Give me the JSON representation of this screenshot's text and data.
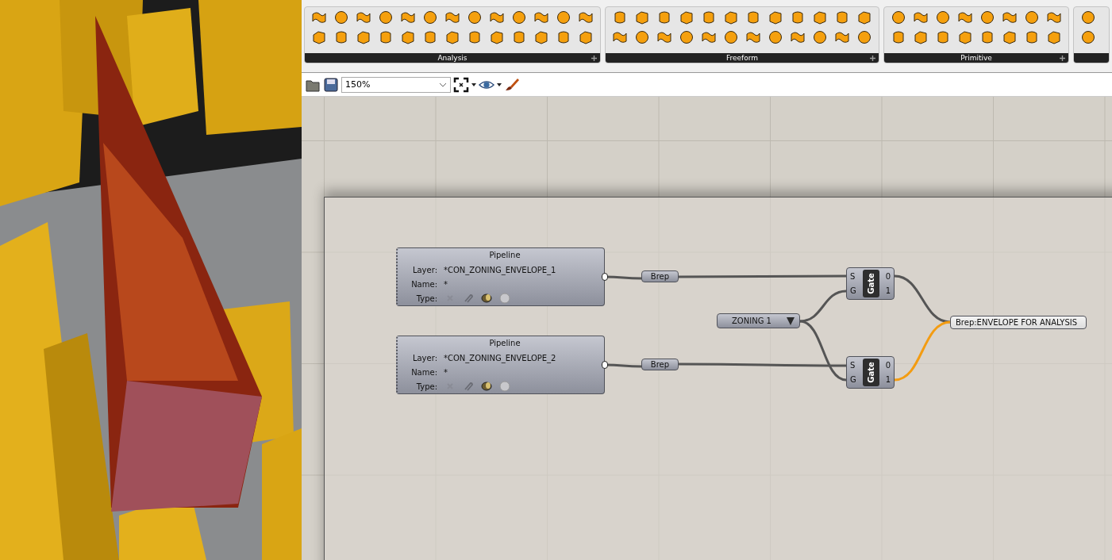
{
  "ribbon": {
    "panels": [
      {
        "label": "Analysis"
      },
      {
        "label": "Freeform"
      },
      {
        "label": "Primitive"
      }
    ]
  },
  "toolbar": {
    "zoom": "150%"
  },
  "canvas": {
    "pipelines": [
      {
        "title": "Pipeline",
        "rows": [
          {
            "label": "Layer:",
            "value": "*CON_ZONING_ENVELOPE_1"
          },
          {
            "label": "Name:",
            "value": "*"
          }
        ],
        "type_label": "Type:"
      },
      {
        "title": "Pipeline",
        "rows": [
          {
            "label": "Layer:",
            "value": "*CON_ZONING_ENVELOPE_2"
          },
          {
            "label": "Name:",
            "value": "*"
          }
        ],
        "type_label": "Type:"
      }
    ],
    "params": [
      {
        "label": "Brep"
      },
      {
        "label": "Brep"
      }
    ],
    "value_list": {
      "value": "ZONING 1"
    },
    "gates": [
      {
        "title": "Gate",
        "inputs": [
          "S",
          "G"
        ],
        "outputs": [
          "0",
          "1"
        ]
      },
      {
        "title": "Gate",
        "inputs": [
          "S",
          "G"
        ],
        "outputs": [
          "0",
          "1"
        ]
      }
    ],
    "output": {
      "label": "Brep:ENVELOPE FOR ANALYSIS"
    },
    "wires": [
      {
        "highlighted": false
      },
      {
        "highlighted": false
      },
      {
        "highlighted": false
      },
      {
        "highlighted": false
      },
      {
        "highlighted": false
      },
      {
        "highlighted": false
      },
      {
        "highlighted": false
      },
      {
        "highlighted": true
      }
    ]
  }
}
